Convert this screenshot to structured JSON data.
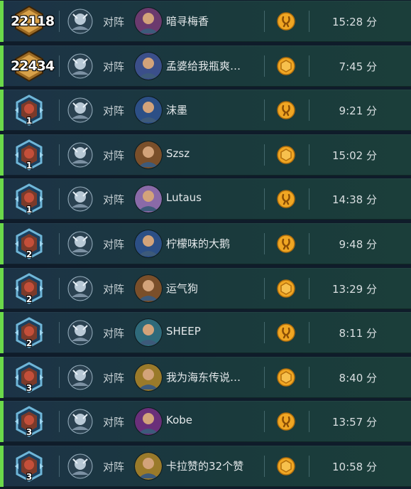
{
  "vs_label": "对阵",
  "games": [
    {
      "rank_type": "legend",
      "legend_rank": "22118",
      "star_level": "",
      "opponent": "暗寻梅香",
      "opponent_portrait": "female-mage-portrait",
      "coin": "first",
      "duration": "15:28 分"
    },
    {
      "rank_type": "legend",
      "legend_rank": "22434",
      "star_level": "",
      "opponent": "孟婆给我瓶爽…",
      "opponent_portrait": "undead-priest-portrait",
      "coin": "second",
      "duration": "7:45 分"
    },
    {
      "rank_type": "rank",
      "legend_rank": "",
      "star_level": "1",
      "opponent": "沫墨",
      "opponent_portrait": "armored-shaman-portrait",
      "coin": "first",
      "duration": "9:21 分"
    },
    {
      "rank_type": "rank",
      "legend_rank": "",
      "star_level": "1",
      "opponent": "Szsz",
      "opponent_portrait": "warrior-portrait",
      "coin": "second",
      "duration": "15:02 分"
    },
    {
      "rank_type": "rank",
      "legend_rank": "",
      "star_level": "1",
      "opponent": "Lutaus",
      "opponent_portrait": "female-elf-portrait",
      "coin": "first",
      "duration": "14:38 分"
    },
    {
      "rank_type": "rank",
      "legend_rank": "",
      "star_level": "2",
      "opponent": "柠檬味的大鹅",
      "opponent_portrait": "armored-shaman-portrait",
      "coin": "first",
      "duration": "9:48 分"
    },
    {
      "rank_type": "rank",
      "legend_rank": "",
      "star_level": "2",
      "opponent": "运气狗",
      "opponent_portrait": "warrior-portrait",
      "coin": "second",
      "duration": "13:29 分"
    },
    {
      "rank_type": "rank",
      "legend_rank": "",
      "star_level": "2",
      "opponent": "SHEEP",
      "opponent_portrait": "rogue-portrait",
      "coin": "first",
      "duration": "8:11 分"
    },
    {
      "rank_type": "rank",
      "legend_rank": "",
      "star_level": "3",
      "opponent": "我为海东传说…",
      "opponent_portrait": "paladin-portrait",
      "coin": "second",
      "duration": "8:40 分"
    },
    {
      "rank_type": "rank",
      "legend_rank": "",
      "star_level": "3",
      "opponent": "Kobe",
      "opponent_portrait": "demon-hunter-portrait",
      "coin": "first",
      "duration": "13:57 分"
    },
    {
      "rank_type": "rank",
      "legend_rank": "",
      "star_level": "3",
      "opponent": "卡拉赞的32个赞",
      "opponent_portrait": "paladin-portrait",
      "coin": "second",
      "duration": "10:58 分"
    }
  ],
  "colors": {
    "win_stripe": "#6bd94a",
    "coin_gold": "#f0a623",
    "text": "#e3e8ea"
  }
}
